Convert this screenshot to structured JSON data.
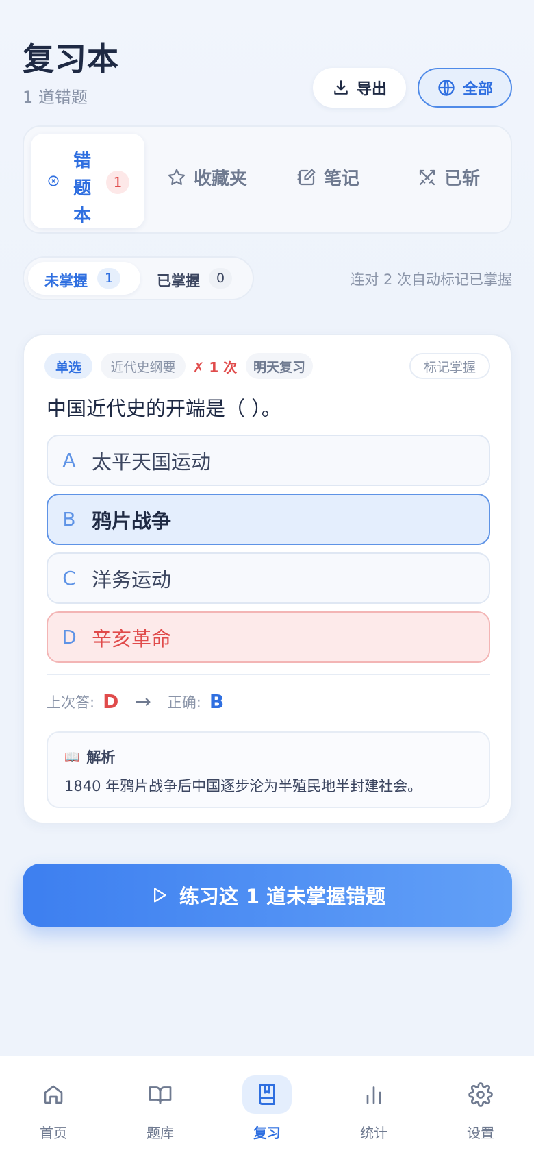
{
  "header": {
    "title": "复习本",
    "subtitle": "1 道错题",
    "export_label": "导出",
    "scope_label": "全部"
  },
  "tabs": [
    {
      "label": "错题本",
      "count": "1",
      "icon": "x-circle-icon",
      "active": true
    },
    {
      "label": "收藏夹",
      "icon": "star-icon"
    },
    {
      "label": "笔记",
      "icon": "note-edit-icon"
    },
    {
      "label": "已斩",
      "icon": "swords-icon"
    }
  ],
  "segment": {
    "unmastered_label": "未掌握",
    "unmastered_count": "1",
    "mastered_label": "已掌握",
    "mastered_count": "0"
  },
  "hint": "连对 2 次自动标记已掌握",
  "question": {
    "type_tag": "单选",
    "subject_tag": "近代史纲要",
    "wrong_tag": "✗ 1 次",
    "review_tag": "明天复习",
    "mark_label": "标记掌握",
    "text": "中国近代史的开端是（ ）。",
    "options": [
      {
        "letter": "A",
        "text": "太平天国运动",
        "state": "normal"
      },
      {
        "letter": "B",
        "text": "鸦片战争",
        "state": "correct"
      },
      {
        "letter": "C",
        "text": "洋务运动",
        "state": "normal"
      },
      {
        "letter": "D",
        "text": "辛亥革命",
        "state": "wrong"
      }
    ],
    "last_answer_label": "上次答:",
    "last_answer": "D",
    "arrow": "→",
    "correct_label": "正确:",
    "correct_answer": "B",
    "explanation_title": "解析",
    "explanation_icon": "📖",
    "explanation": "1840 年鸦片战争后中国逐步沦为半殖民地半封建社会。"
  },
  "cta_label": "练习这 1 道未掌握错题",
  "nav": [
    {
      "label": "首页",
      "icon": "home-icon"
    },
    {
      "label": "题库",
      "icon": "book-open-icon"
    },
    {
      "label": "复习",
      "icon": "bookmark-book-icon",
      "active": true
    },
    {
      "label": "统计",
      "icon": "bar-chart-icon"
    },
    {
      "label": "设置",
      "icon": "gear-icon"
    }
  ],
  "colors": {
    "accent": "#2f6fe0",
    "danger": "#e04b4b",
    "background": "#eef3fb"
  }
}
